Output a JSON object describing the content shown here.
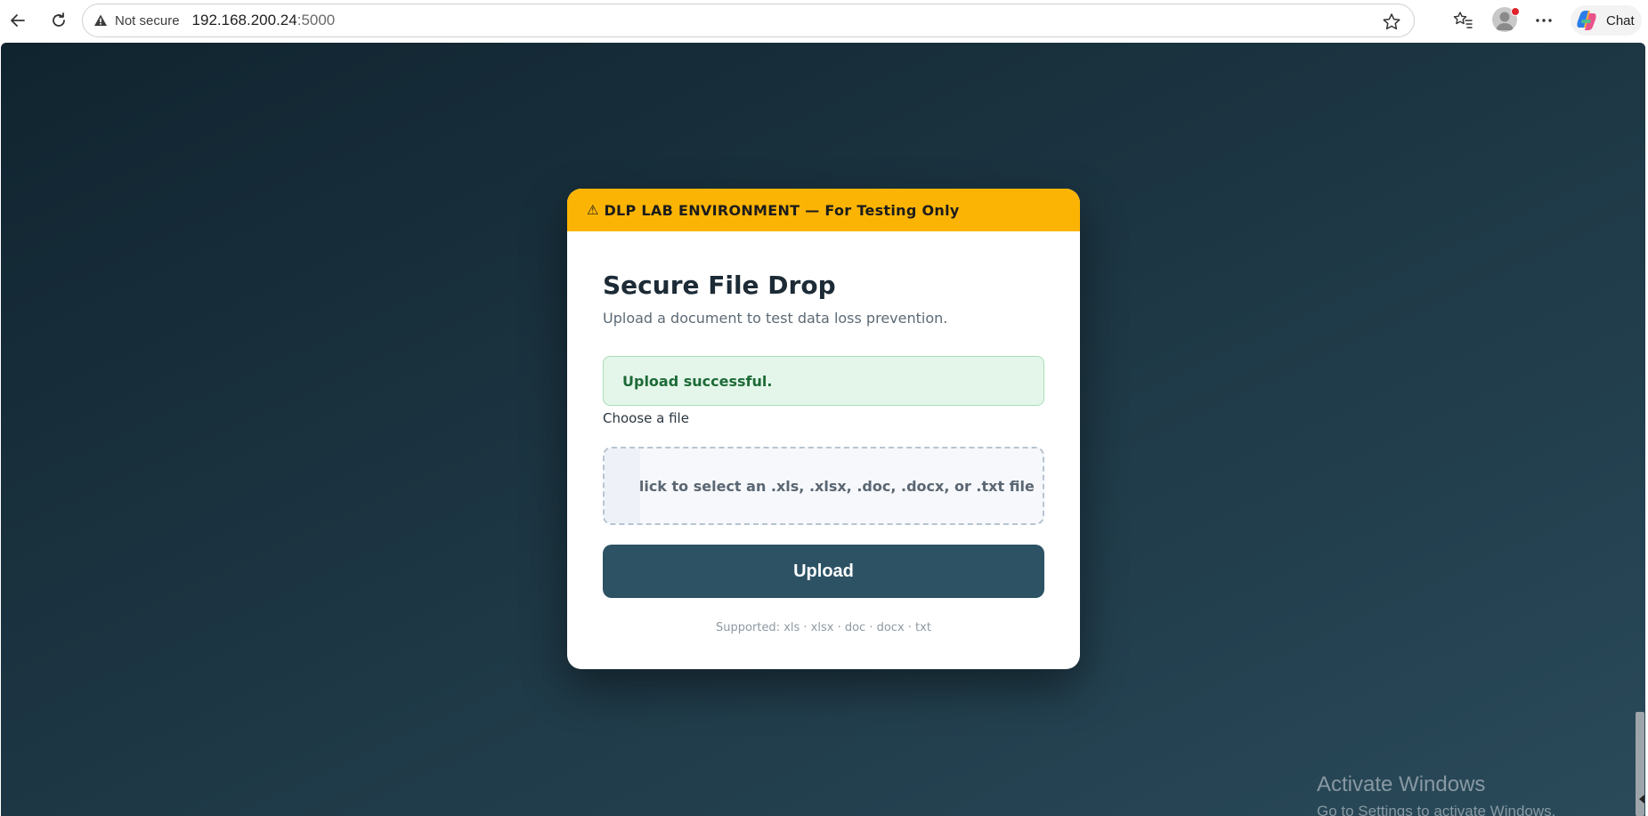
{
  "browser": {
    "security_label": "Not secure",
    "url_host": "192.168.200.24",
    "url_port": ":5000",
    "chat_label": "Chat",
    "icons": {
      "back": "arrow-left-icon",
      "reload": "reload-icon",
      "security": "warning-triangle-icon",
      "favorite": "star-icon",
      "favorites_list": "favorites-icon",
      "profile": "avatar",
      "menu": "more-icon",
      "copilot": "copilot-icon"
    }
  },
  "card": {
    "banner": {
      "glyph": "⚠",
      "text": "DLP LAB ENVIRONMENT — For Testing Only",
      "color": "#fbb404"
    },
    "title": "Secure File Drop",
    "subtitle": "Upload a document to test data loss prevention.",
    "alert": {
      "text": "Upload successful.",
      "type": "success"
    },
    "file_label": "Choose a file",
    "dropzone_text": "Click to select an .xls, .xlsx, .doc, .docx, or .txt file",
    "upload_label": "Upload",
    "supported": "Supported: xls · xlsx · doc · docx · txt",
    "accent_color": "#2c5264"
  },
  "watermark": {
    "title": "Activate Windows",
    "subtitle": "Go to Settings to activate Windows."
  }
}
